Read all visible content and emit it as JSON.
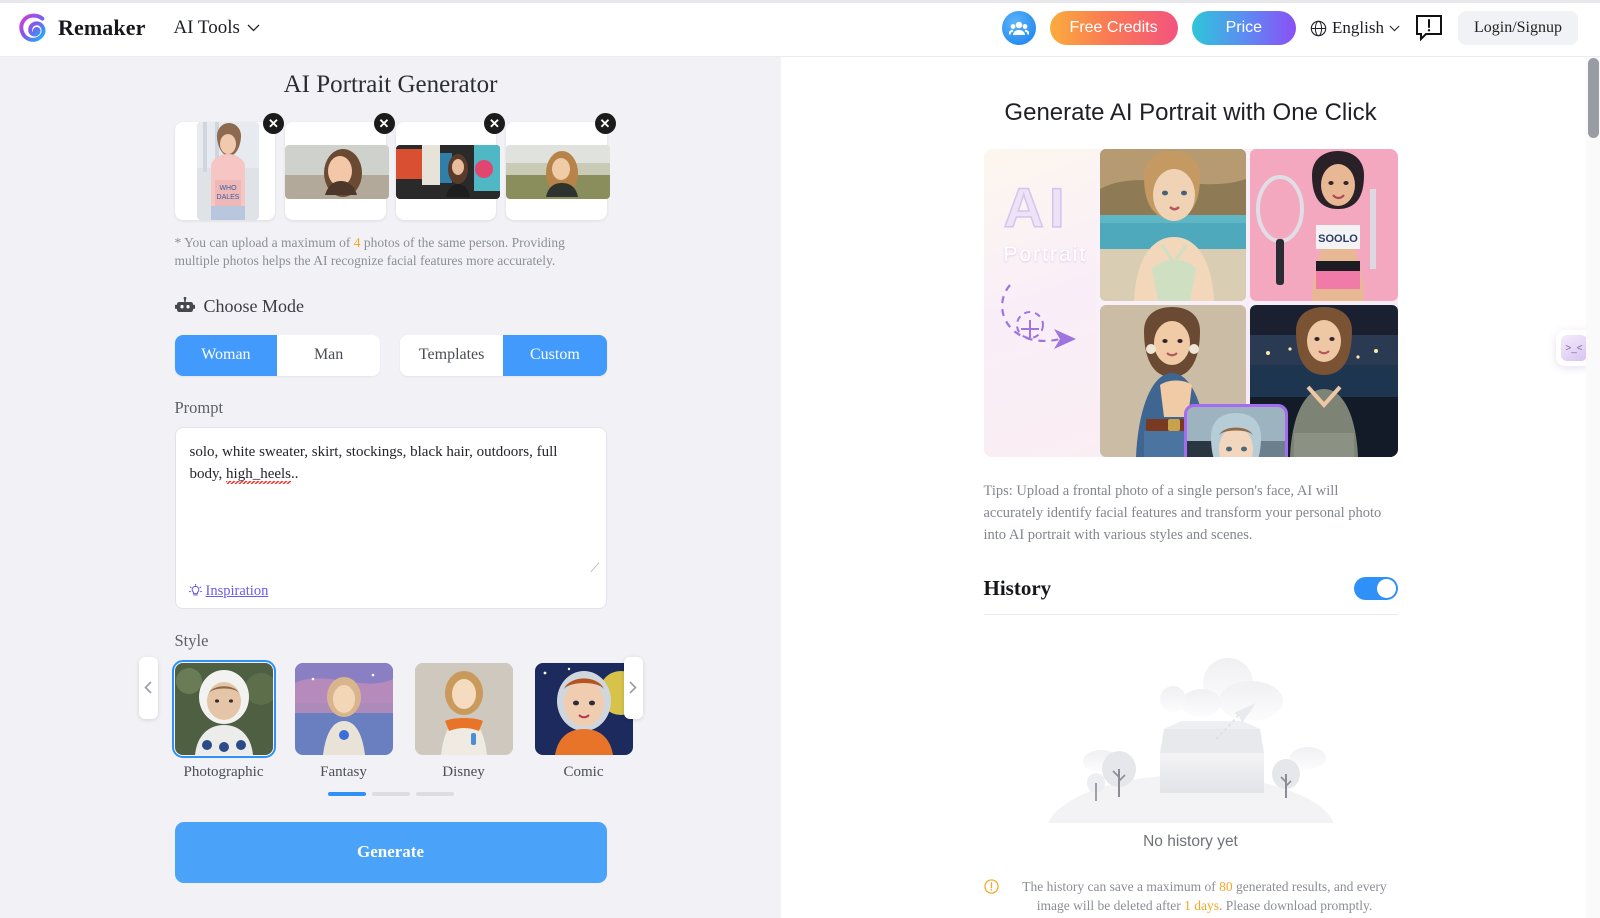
{
  "header": {
    "brand_name": "Remaker",
    "nav_label": "AI Tools",
    "free_credits_label": "Free Credits",
    "price_label": "Price",
    "language_label": "English",
    "login_label": "Login/Signup",
    "icons": {
      "logo": "remaker-logo-icon",
      "chevron": "chevron-down-icon",
      "people": "people-icon",
      "globe": "globe-icon",
      "feedback": "feedback-icon"
    }
  },
  "left": {
    "title": "AI Portrait Generator",
    "uploads": [
      {
        "alt": "uploaded-photo-1",
        "remove_label": "✕"
      },
      {
        "alt": "uploaded-photo-2",
        "remove_label": "✕"
      },
      {
        "alt": "uploaded-photo-3",
        "remove_label": "✕"
      },
      {
        "alt": "uploaded-photo-4",
        "remove_label": "✕"
      }
    ],
    "upload_note_a": "* You can upload a maximum of ",
    "upload_note_count": "4",
    "upload_note_b": " photos of the same person. Providing multiple photos helps the AI recognize facial features more accurately.",
    "choose_mode_label": "Choose Mode",
    "gender_options": [
      "Woman",
      "Man"
    ],
    "gender_selected": "Woman",
    "source_options": [
      "Templates",
      "Custom"
    ],
    "source_selected": "Custom",
    "prompt_label": "Prompt",
    "prompt_value_a": "solo, white sweater, skirt, stockings, black hair, outdoors, full body, ",
    "prompt_value_misspelled": "high_heels",
    "prompt_value_b": "..",
    "inspiration_label": "Inspiration",
    "style_label": "Style",
    "styles": [
      {
        "name": "Photographic",
        "selected": true
      },
      {
        "name": "Fantasy",
        "selected": false
      },
      {
        "name": "Disney",
        "selected": false
      },
      {
        "name": "Comic",
        "selected": false
      }
    ],
    "carousel_prev": "‹",
    "carousel_next": "›",
    "page_dots": 3,
    "active_dot": 1,
    "generate_label": "Generate"
  },
  "right": {
    "title": "Generate AI Portrait with One Click",
    "hero_ai_text": "AI",
    "hero_portrait_text": "Portrait",
    "tips": "Tips: Upload a frontal photo of a single person's face, AI will accurately identify facial features and transform your personal photo into AI portrait with various styles and scenes.",
    "history_title": "History",
    "history_toggle_on": true,
    "empty_text": "No history yet",
    "note_a": "The history can save a maximum of ",
    "note_count": "80",
    "note_b": " generated results, and every image will be deleted after ",
    "note_days": "1 days",
    "note_c": ". Please download promptly."
  },
  "widget": {
    "face_label": ">_<"
  },
  "colors": {
    "accent_blue": "#2f90f7",
    "generate_blue": "#4aa3f8",
    "orange": "#f5a623",
    "purple_link": "#6b5ce7",
    "panel_bg": "#f2f2f6"
  }
}
